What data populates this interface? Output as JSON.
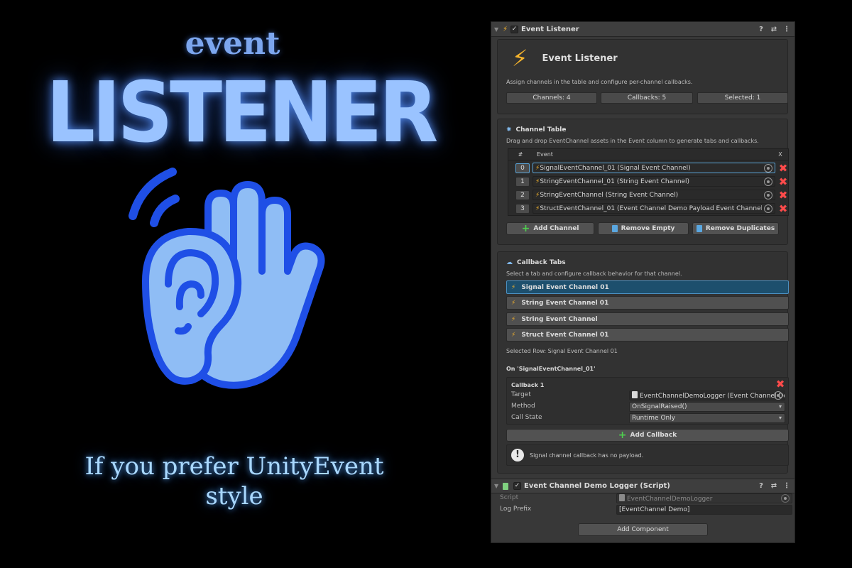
{
  "promo": {
    "event_word": "event",
    "listener_word": "LISTENER",
    "tagline_line1": "If you prefer UnityEvent",
    "tagline_line2": "style",
    "hero_icon": "ear-and-hand-listening-icon"
  },
  "inspector": {
    "event_listener_header": "Event Listener",
    "title": "Event Listener",
    "description": "Assign channels in the table and configure per-channel callbacks.",
    "stats": {
      "channels": "Channels: 4",
      "callbacks": "Callbacks: 5",
      "selected": "Selected: 1"
    },
    "channel_table": {
      "title": "Channel Table",
      "description": "Drag and drop EventChannel assets in the Event column to generate tabs and callbacks.",
      "columns": [
        "#",
        "Event",
        "X"
      ],
      "rows": [
        {
          "index": "0",
          "event": "SignalEventChannel_01 (Signal Event Channel)"
        },
        {
          "index": "1",
          "event": "StringEventChannel_01 (String Event Channel)"
        },
        {
          "index": "2",
          "event": "StringEventChannel (String Event Channel)"
        },
        {
          "index": "3",
          "event": "StructEventChannel_01 (Event Channel Demo Payload Event Channel)"
        }
      ],
      "add_channel": "Add Channel",
      "remove_empty": "Remove Empty",
      "remove_duplicates": "Remove Duplicates"
    },
    "callback_tabs": {
      "title": "Callback Tabs",
      "description": "Select a tab and configure callback behavior for that channel.",
      "tabs": [
        "Signal Event Channel 01",
        "String Event Channel 01",
        "String Event Channel",
        "Struct Event Channel 01"
      ],
      "selected_row": "Selected Row: Signal Event Channel 01",
      "on_label": "On 'SignalEventChannel_01'",
      "callback": {
        "title": "Callback 1",
        "target_label": "Target",
        "target_value": "EventChannelDemoLogger (Event Channel Demo Logger)",
        "method_label": "Method",
        "method_value": "OnSignalRaised()",
        "call_state_label": "Call State",
        "call_state_value": "Runtime Only"
      },
      "add_callback": "Add Callback",
      "info": "Signal channel callback has no payload."
    },
    "logger": {
      "header": "Event Channel Demo Logger (Script)",
      "script_label": "Script",
      "script_value": "EventChannelDemoLogger",
      "log_prefix_label": "Log Prefix",
      "log_prefix_value": "[EventChannel Demo]"
    },
    "add_component": "Add Component"
  },
  "colors": {
    "accent_blue": "#9ac3ff",
    "hero_dark_blue": "#1f4fe6",
    "hero_light_blue": "#8fbdf5",
    "bolt_yellow": "#f6b42c",
    "remove_red": "#ff4b4b",
    "add_green": "#4fd04f",
    "selected_tab": "#1d4f6d"
  }
}
